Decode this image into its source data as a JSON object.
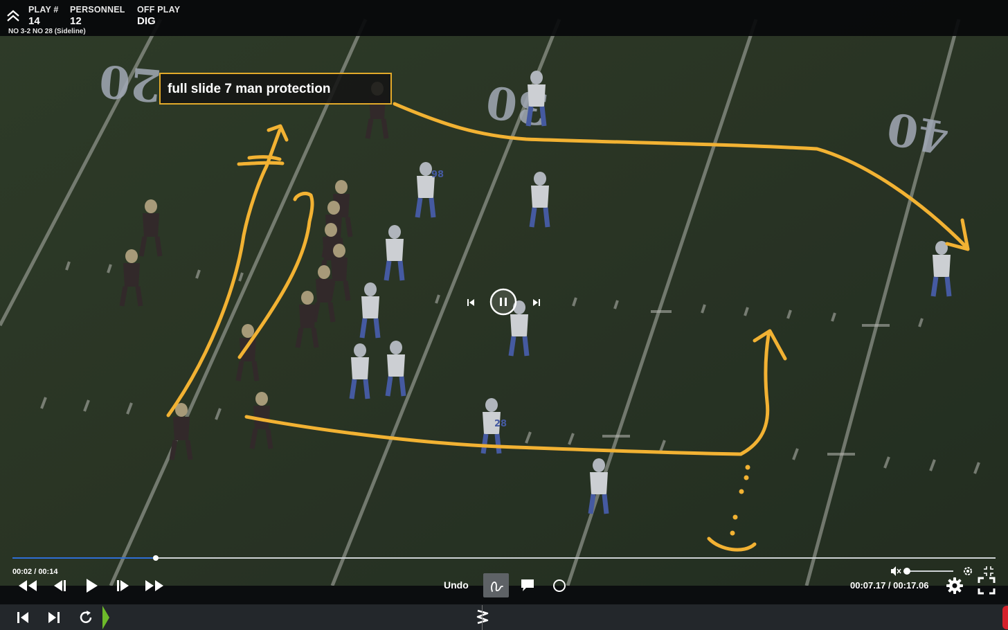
{
  "header": {
    "play_label": "PLAY #",
    "play_value": "14",
    "personnel_label": "PERSONNEL",
    "personnel_value": "12",
    "off_play_label": "OFF PLAY",
    "off_play_value": "DIG",
    "situation": "NO  3-2  NO 28 (Sideline)"
  },
  "annotation": {
    "note_text": "full slide 7 man protection",
    "stroke_color": "#f2b233"
  },
  "field": {
    "yard_numbers": [
      "20",
      "30",
      "40"
    ],
    "away_jersey_numbers": [
      "98",
      "28"
    ]
  },
  "player": {
    "current_time": "00:02",
    "duration": "00:14",
    "time_separator": " / ",
    "progress_fraction": 0.146,
    "clip_time": "00:07.17 / 00:17.06",
    "undo_label": "Undo",
    "accent_color": "#2f6fd6"
  },
  "icons": {
    "collapse": "chevron-up-double-icon",
    "rewind": "rewind-icon",
    "step_back": "step-back-icon",
    "play": "play-icon",
    "step_forward": "step-forward-icon",
    "fast_forward": "fast-forward-icon",
    "draw": "draw-icon",
    "comment": "comment-icon",
    "circle": "circle-icon",
    "mute": "mute-icon",
    "settings": "gear-icon",
    "fullscreen": "fullscreen-icon",
    "prev_clip": "skip-previous-icon",
    "next_clip": "skip-next-icon",
    "replay": "replay-icon",
    "timeline_marker": "zigzag-marker-icon"
  }
}
